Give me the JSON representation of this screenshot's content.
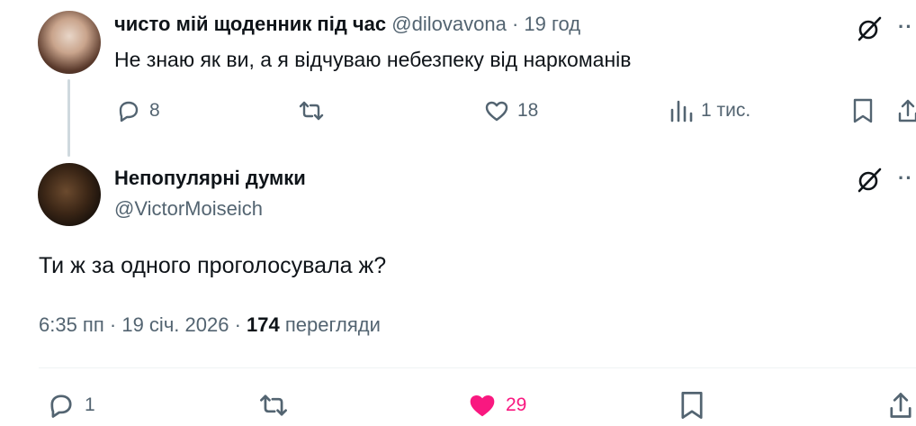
{
  "parent_tweet": {
    "display_name": "чисто мій щоденник під час",
    "handle": "@dilovavona",
    "separator": "·",
    "time": "19 год",
    "text": "Не знаю як ви, а я відчуваю небезпеку від наркоманів",
    "replies": "8",
    "likes": "18",
    "views": "1 тис."
  },
  "reply_tweet": {
    "display_name": "Непопулярні думки",
    "handle": "@VictorMoiseich",
    "text": "Ти ж за одного проголосувала ж?",
    "time": "6:35 пп",
    "separator": "·",
    "date": "19 січ. 2026",
    "views_count": "174",
    "views_label": "перегляди",
    "replies": "1",
    "likes": "29",
    "liked": true
  },
  "colors": {
    "text_primary": "#0f1419",
    "text_secondary": "#536471",
    "like_active": "#f91880",
    "thread_line": "#cfd9de",
    "divider": "#eff3f4"
  },
  "icons": [
    "grok-icon",
    "more-icon",
    "reply-icon",
    "retweet-icon",
    "like-icon",
    "views-icon",
    "bookmark-icon",
    "share-icon"
  ]
}
